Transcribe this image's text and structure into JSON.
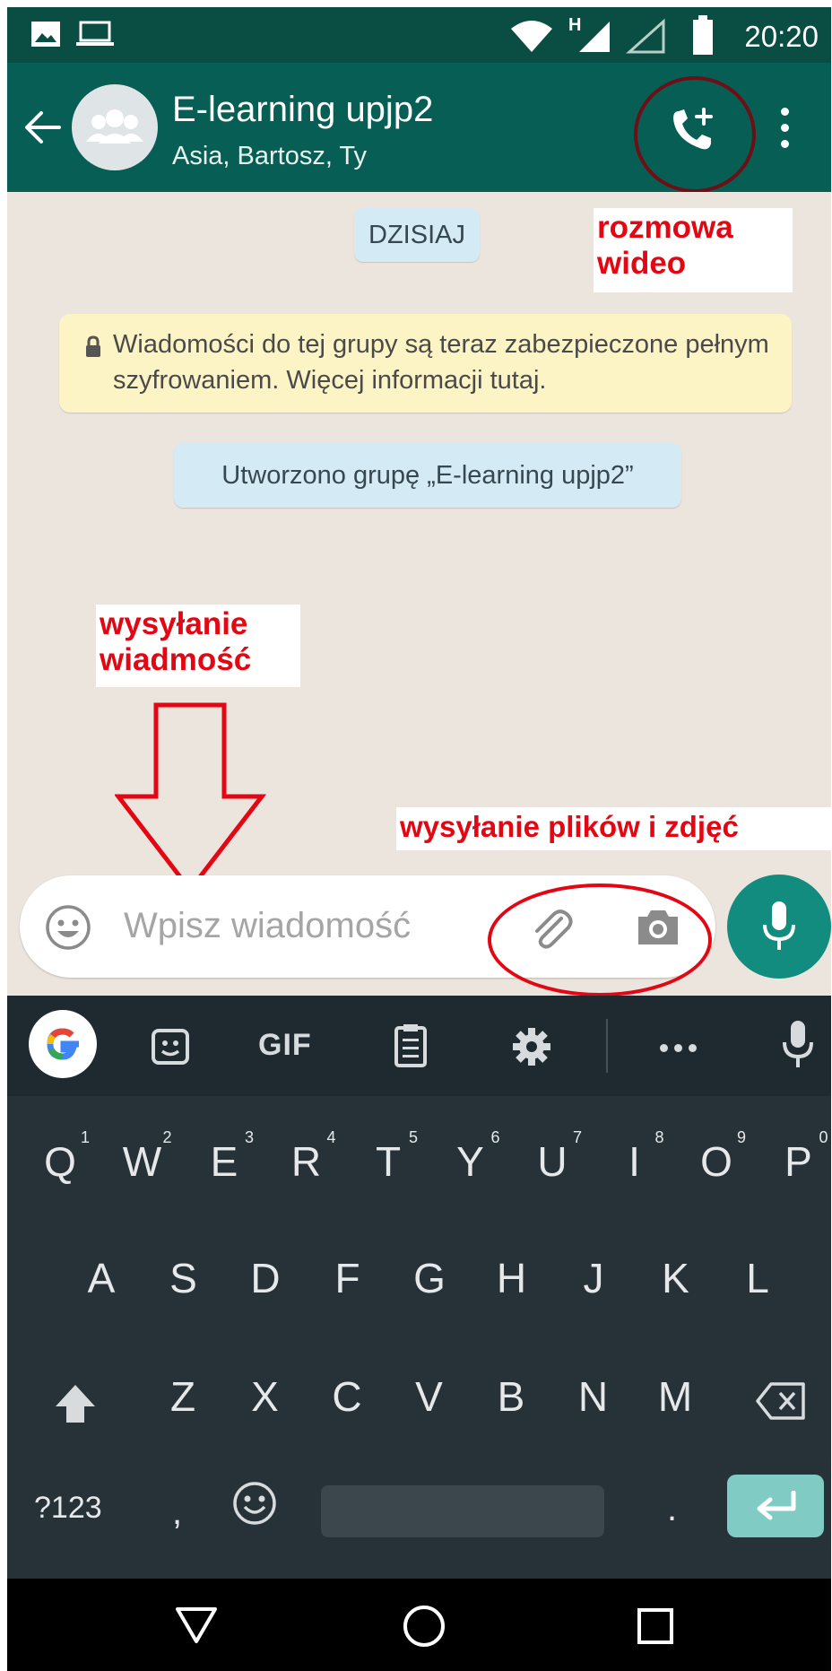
{
  "status_bar": {
    "time": "20:20"
  },
  "header": {
    "title": "E-learning upjp2",
    "subtitle": "Asia, Bartosz, Ty"
  },
  "chat": {
    "date_label": "DZISIAJ",
    "encryption_notice": "Wiadomości do tej grupy są teraz zabezpieczone pełnym szyfrowaniem. Więcej informacji tutaj.",
    "system_message": "Utworzono grupę „E-learning upjp2”"
  },
  "annotations": {
    "video_call_line1": "rozmowa",
    "video_call_line2": "wideo",
    "send_message_line1": "wysyłanie",
    "send_message_line2": "wiadmość",
    "attachments": "wysyłanie plików i zdjęć",
    "color": "#e30613"
  },
  "input": {
    "placeholder": "Wpisz wiadomość"
  },
  "keyboard": {
    "toolbar": {
      "gif": "GIF"
    },
    "row1": [
      "Q",
      "W",
      "E",
      "R",
      "T",
      "Y",
      "U",
      "I",
      "O",
      "P"
    ],
    "row1_hints": [
      "1",
      "2",
      "3",
      "4",
      "5",
      "6",
      "7",
      "8",
      "9",
      "0"
    ],
    "row2": [
      "A",
      "S",
      "D",
      "F",
      "G",
      "H",
      "J",
      "K",
      "L"
    ],
    "row3": [
      "Z",
      "X",
      "C",
      "V",
      "B",
      "N",
      "M"
    ],
    "symbols_key": "?123",
    "comma": ",",
    "period": "."
  },
  "colors": {
    "header": "#075e54",
    "status_bar": "#0a4d42",
    "chat_bg": "#ece5dd",
    "accent": "#128c7e",
    "keyboard_bg": "#263238"
  }
}
